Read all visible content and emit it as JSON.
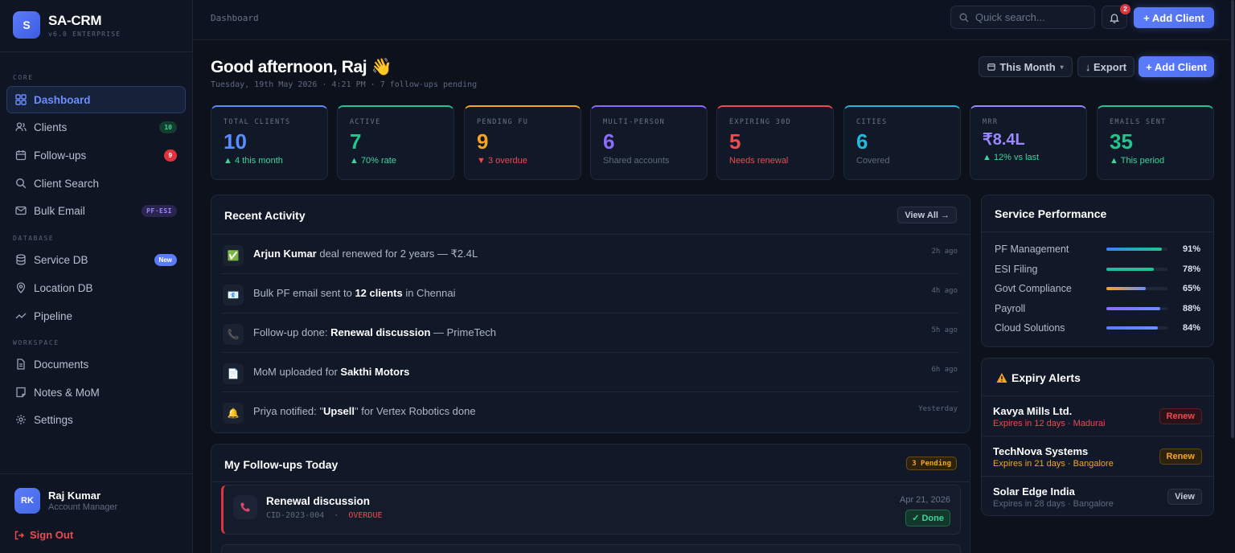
{
  "brand": {
    "logo": "S",
    "name": "SA-CRM",
    "version": "v6.0 ENTERPRISE"
  },
  "sidebar": {
    "sections": [
      "CORE",
      "DATABASE",
      "WORKSPACE"
    ],
    "items": [
      {
        "label": "Dashboard",
        "icon": "grid-icon"
      },
      {
        "label": "Clients",
        "icon": "users-icon",
        "badge": "10"
      },
      {
        "label": "Follow-ups",
        "icon": "calendar-icon",
        "badge": "9"
      },
      {
        "label": "Client Search",
        "icon": "search-icon"
      },
      {
        "label": "Bulk Email",
        "icon": "mail-icon",
        "badge": "PF·ESI"
      },
      {
        "label": "Service DB",
        "icon": "database-icon",
        "badge": "New"
      },
      {
        "label": "Location DB",
        "icon": "map-pin-icon"
      },
      {
        "label": "Pipeline",
        "icon": "trend-icon"
      },
      {
        "label": "Documents",
        "icon": "document-icon"
      },
      {
        "label": "Notes & MoM",
        "icon": "note-icon"
      },
      {
        "label": "Settings",
        "icon": "gear-icon"
      }
    ],
    "user": {
      "initials": "RK",
      "name": "Raj Kumar",
      "role": "Account Manager"
    },
    "signout": "Sign Out"
  },
  "topbar": {
    "breadcrumb": "Dashboard",
    "search_placeholder": "Quick search...",
    "bell_count": "2",
    "add_client": "+ Add Client"
  },
  "header": {
    "greeting": "Good afternoon, Raj 👋",
    "subline": "Tuesday, 19th May 2026 · 4:21 PM · 7 follow-ups pending",
    "period": "This Month",
    "export": "↓ Export",
    "add_client": "+ Add Client"
  },
  "stats": [
    {
      "label": "TOTAL CLIENTS",
      "value": "10",
      "sub": "▲ 4 this month",
      "color": "#5b8cff",
      "subcolor": "#3fd49a"
    },
    {
      "label": "ACTIVE",
      "value": "7",
      "sub": "▲ 70% rate",
      "color": "#22c58b",
      "subcolor": "#3fd49a"
    },
    {
      "label": "PENDING FU",
      "value": "9",
      "sub": "▼ 3 overdue",
      "color": "#f5a524",
      "subcolor": "#ef4a52"
    },
    {
      "label": "MULTI-PERSON",
      "value": "6",
      "sub": "Shared accounts",
      "color": "#8b6cff",
      "subcolor": "#5f6a80"
    },
    {
      "label": "EXPIRING 30D",
      "value": "5",
      "sub": "Needs renewal",
      "color": "#ef4a52",
      "subcolor": "#ef4a52"
    },
    {
      "label": "CITIES",
      "value": "6",
      "sub": "Covered",
      "color": "#22b8d8",
      "subcolor": "#5f6a80"
    },
    {
      "label": "MRR",
      "value": "₹8.4L",
      "sub": "▲ 12% vs last",
      "color": "#9b87ff",
      "subcolor": "#3fd49a"
    },
    {
      "label": "EMAILS SENT",
      "value": "35",
      "sub": "▲ This period",
      "color": "#22c58b",
      "subcolor": "#3fd49a"
    }
  ],
  "activity": {
    "title": "Recent Activity",
    "view_all": "View All →",
    "items": [
      {
        "icon": "✅",
        "bold1": "Arjun Kumar",
        "text1": " deal renewed for 2 years — ₹2.4L",
        "bold2": "",
        "text2": "",
        "time": "2h ago"
      },
      {
        "icon": "📧",
        "bold1": "",
        "text1": "Bulk PF email sent to ",
        "bold2": "12 clients",
        "text2": " in Chennai",
        "time": "4h ago"
      },
      {
        "icon": "📞",
        "bold1": "",
        "text1": "Follow-up done: ",
        "bold2": "Renewal discussion",
        "text2": " — PrimeTech",
        "time": "5h ago"
      },
      {
        "icon": "📄",
        "bold1": "",
        "text1": "MoM uploaded for ",
        "bold2": "Sakthi Motors",
        "text2": "",
        "time": "6h ago"
      },
      {
        "icon": "🔔",
        "bold1": "",
        "text1": "Priya notified: \"",
        "bold2": "Upsell",
        "text2": "\" for Vertex Robotics done",
        "time": "Yesterday"
      }
    ]
  },
  "performance": {
    "title": "Service Performance",
    "rows": [
      {
        "name": "PF Management",
        "value": 91,
        "label": "91%",
        "color1": "#3b82f6",
        "color2": "#22c58b"
      },
      {
        "name": "ESI Filing",
        "value": 78,
        "label": "78%",
        "color1": "#22b8a8",
        "color2": "#22c58b"
      },
      {
        "name": "Govt Compliance",
        "value": 65,
        "label": "65%",
        "color1": "#f5a524",
        "color2": "#6d8dff"
      },
      {
        "name": "Payroll",
        "value": 88,
        "label": "88%",
        "color1": "#8b6cff",
        "color2": "#6d8dff"
      },
      {
        "name": "Cloud Solutions",
        "value": 84,
        "label": "84%",
        "color1": "#5b7cfa",
        "color2": "#6d8dff"
      }
    ]
  },
  "expiry": {
    "title": "Expiry Alerts",
    "rows": [
      {
        "name": "Kavya Mills Ltd.",
        "meta": "Expires in 12 days · Madurai",
        "btn": "Renew",
        "metacolor": "#ef4a52",
        "btncolor": "#ef4a52",
        "btnbg": "#2a1318",
        "btnborder": "#5a1e26"
      },
      {
        "name": "TechNova Systems",
        "meta": "Expires in 21 days · Bangalore",
        "btn": "Renew",
        "metacolor": "#f5a524",
        "btncolor": "#f5a524",
        "btnbg": "#2d220e",
        "btnborder": "#5e4415"
      },
      {
        "name": "Solar Edge India",
        "meta": "Expires in 28 days · Bangalore",
        "btn": "View",
        "metacolor": "#5f6a80",
        "btncolor": "#c4ccd9",
        "btnbg": "#1a2232",
        "btnborder": "#2c3548"
      }
    ]
  },
  "followups": {
    "title": "My Follow-ups Today",
    "pending": "3 Pending",
    "items": [
      {
        "title": "Renewal discussion",
        "cid": "CID-2023-004",
        "status": "OVERDUE",
        "date": "Apr 21, 2026",
        "done": "✓ Done"
      }
    ]
  }
}
